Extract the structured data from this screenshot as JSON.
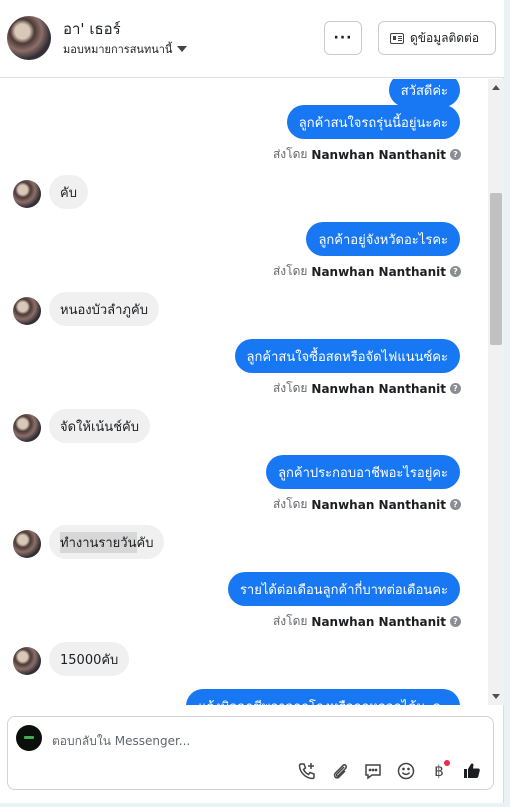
{
  "header": {
    "name": "อา' เธอร์",
    "subtitle": "มอบหมายการสนทนานี้",
    "more_label": "···",
    "contact_label": "ดูข้อมูลติดต่อ"
  },
  "sent_by_prefix": "ส่งโดย",
  "sender_name": "Nanwhan Nanthanit",
  "messages": {
    "m0": "สวัสดีค่ะ",
    "m1": "ลูกค้าสนใจรถรุ่นนี้อยู่นะคะ",
    "m2": "คับ",
    "m3": "ลูกค้าอยู่จังหวัดอะไรคะ",
    "m4": "หนองบัวลำภูคับ",
    "m5": "ลูกค้าสนใจซื้อสดหรือจัดไฟแนนซ์คะ",
    "m6": "จัดให้เน้นช์คับ",
    "m7": "ลูกค้าประกอบอาชีพอะไรอยู่คะ",
    "m8_highlight": "ทำงานรายวัน",
    "m8_rest": "คับ",
    "m9": "รายได้ต่อเดือนลูกค้ากี่บาทต่อเดือนคะ",
    "m10": "15000คับ",
    "m11": "แจ้งมิจฉาชีพอาจถูกโกงหรือถูกหลอกได้นะคะ"
  },
  "composer": {
    "placeholder": "ตอบกลับใน Messenger..."
  },
  "icons": [
    "phone-plus-icon",
    "paperclip-icon",
    "chat-bubble-icon",
    "smiley-icon",
    "baht-icon",
    "thumbs-up-icon"
  ],
  "colors": {
    "accent": "#1877f2",
    "incoming_bg": "#f0f0f0",
    "notification_dot": "#f0284a"
  }
}
